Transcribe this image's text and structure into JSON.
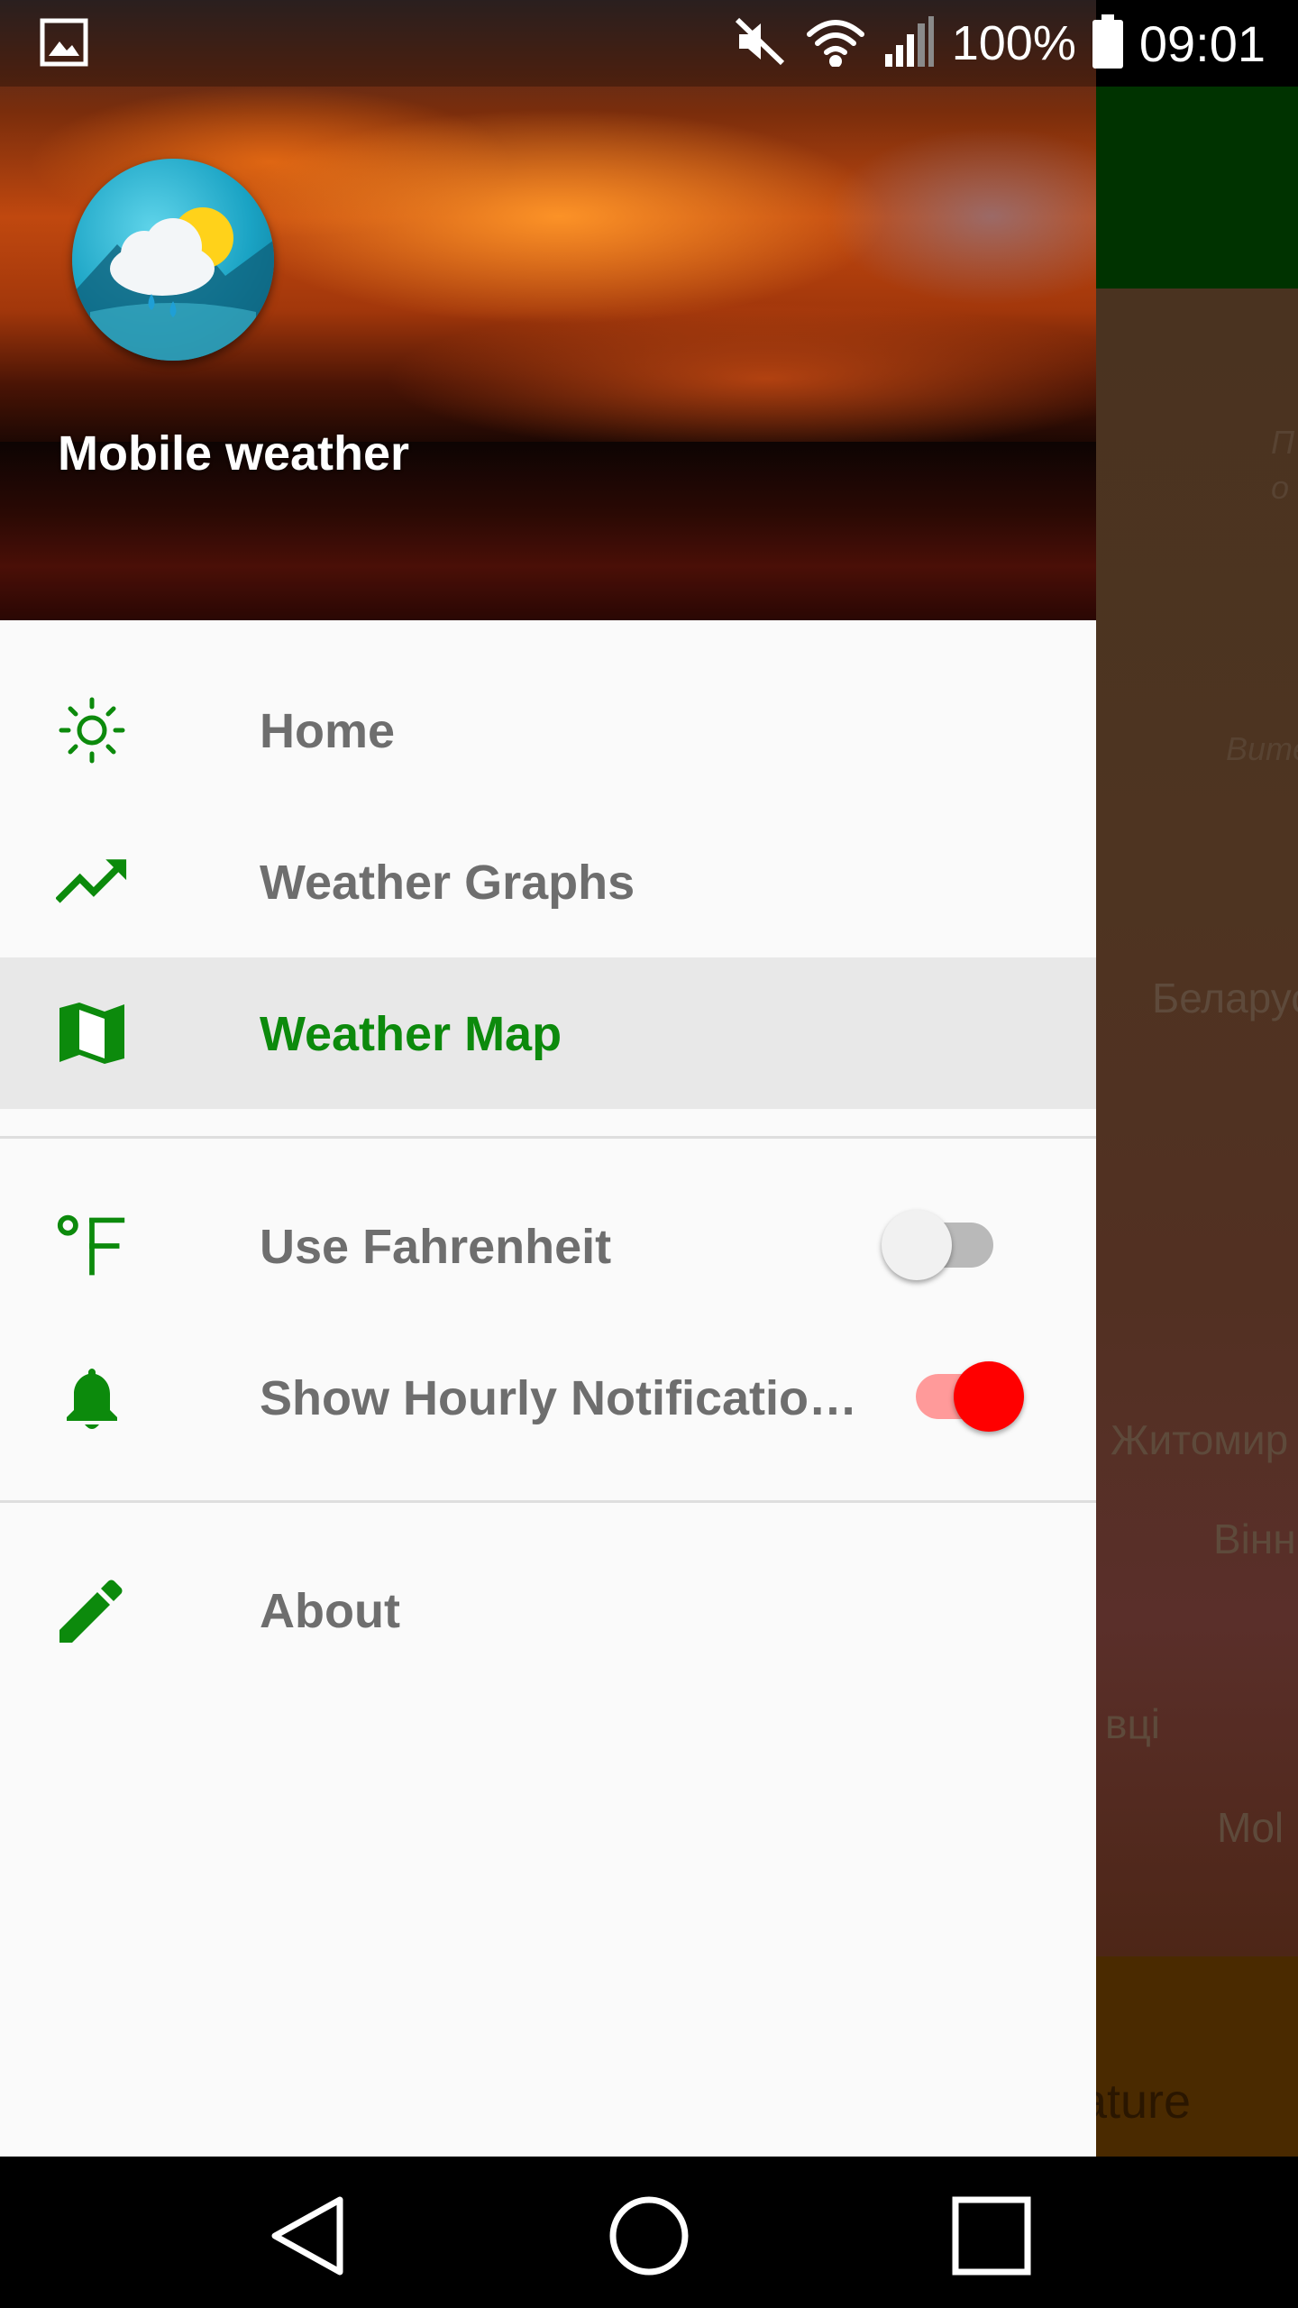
{
  "status_bar": {
    "battery_percent": "100%",
    "time": "09:01",
    "icons": [
      "gallery-icon",
      "mute-icon",
      "wifi-icon",
      "cell-signal-icon",
      "battery-icon"
    ]
  },
  "background": {
    "map_labels": [
      "Витебская обл.",
      "Беларусь",
      "Житомир",
      "Вінн",
      "вці",
      "Mol",
      "П",
      "о"
    ],
    "bottom_bar_text": "rature",
    "colors": {
      "top_bar": "#003300",
      "bottom_bar": "#4a2a00"
    }
  },
  "drawer": {
    "header": {
      "app_name": "Mobile weather",
      "logo_icon": "weather-app-logo-icon"
    },
    "menu": [
      {
        "label": "Home",
        "icon": "sun-icon",
        "active": false
      },
      {
        "label": "Weather Graphs",
        "icon": "trending-up-icon",
        "active": false
      },
      {
        "label": "Weather Map",
        "icon": "map-icon",
        "active": true
      }
    ],
    "settings": [
      {
        "label": "Use Fahrenheit",
        "icon": "fahrenheit-icon",
        "toggle": false
      },
      {
        "label": "Show Hourly Notificatio…",
        "icon": "bell-icon",
        "toggle": true
      }
    ],
    "footer": [
      {
        "label": "About",
        "icon": "pencil-icon"
      }
    ],
    "colors": {
      "accent": "#0c8a0c",
      "toggle_on": "#ff0000",
      "toggle_on_track": "#ff9a9a",
      "active_bg": "#e8e8e8",
      "label": "#6e6e6e"
    }
  },
  "nav_bar": {
    "buttons": [
      "back-icon",
      "home-icon",
      "recents-icon"
    ]
  }
}
